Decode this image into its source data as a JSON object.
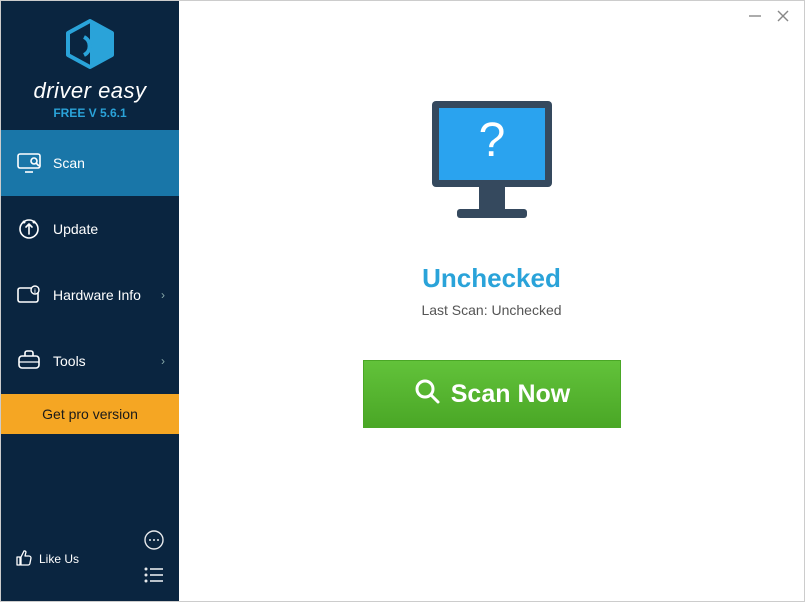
{
  "brand": {
    "name": "driver easy",
    "version": "FREE V 5.6.1"
  },
  "sidebar": {
    "items": [
      {
        "label": "Scan"
      },
      {
        "label": "Update"
      },
      {
        "label": "Hardware Info"
      },
      {
        "label": "Tools"
      }
    ],
    "pro_label": "Get pro version",
    "like_us": "Like Us"
  },
  "main": {
    "status_title": "Unchecked",
    "status_sub_prefix": "Last Scan: ",
    "status_sub_value": "Unchecked",
    "scan_button": "Scan Now"
  }
}
